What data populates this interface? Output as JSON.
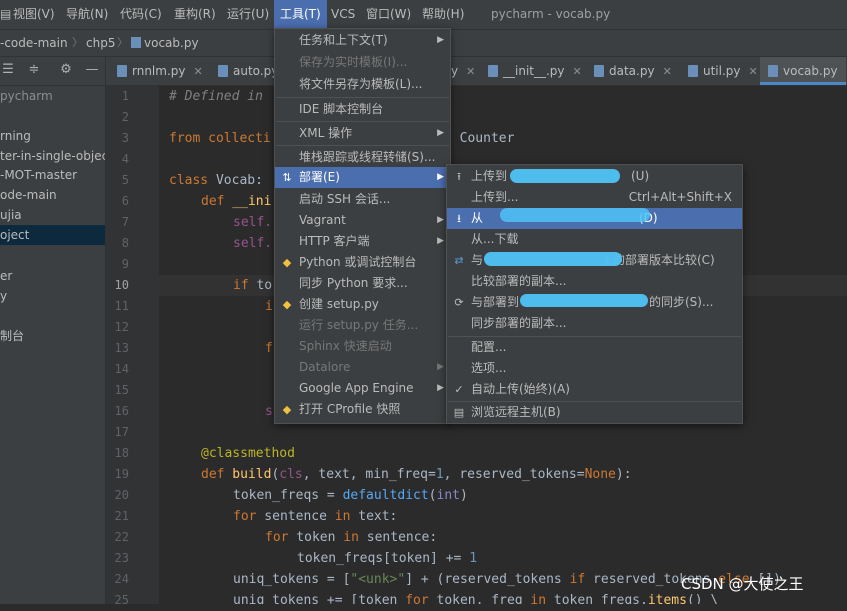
{
  "menubar": {
    "items": [
      "视图(V)",
      "导航(N)",
      "代码(C)",
      "重构(R)",
      "运行(U)",
      "工具(T)",
      "VCS",
      "窗口(W)",
      "帮助(H)"
    ],
    "window_title": "pycharm - vocab.py"
  },
  "breadcrumbs": [
    "-code-main",
    "chp5",
    "vocab.py"
  ],
  "left_panel": {
    "items": [
      "pycharm",
      "rning",
      "ter-in-single-objec",
      "-MOT-master",
      "ode-main",
      "ujia",
      "oject",
      "er",
      "y",
      "制台"
    ]
  },
  "tabs": [
    "rnnlm.py",
    "auto.py",
    "y",
    "__init__.py",
    "data.py",
    "util.py",
    "vocab.py"
  ],
  "line_numbers": [
    "1",
    "2",
    "3",
    "4",
    "5",
    "6",
    "7",
    "8",
    "9",
    "10",
    "11",
    "12",
    "13",
    "14",
    "15",
    "16",
    "17",
    "18",
    "19",
    "20",
    "21",
    "22",
    "23",
    "24",
    "25"
  ],
  "code": {
    "l1": "# Defined in",
    "l3a": "from collecti",
    "l3b": ", Counter",
    "l5a": "class",
    "l5b": " Vocab:",
    "l6a": "def",
    "l6b": " __ini",
    "l7": "self.",
    "l8": "self.",
    "l10a": "if",
    "l10b": " to",
    "l11": "i",
    "l13": "f",
    "l16": "s",
    "l18": "@classmethod",
    "l19a": "def",
    "l19b": " build",
    "l19c": "(",
    "l19d": "cls",
    "l19e": ", text, ",
    "l19f": "min_freq",
    "l19g": "=",
    "l19h": "1",
    "l19i": ", ",
    "l19j": "reserved_tokens",
    "l19k": "=",
    "l19l": "None",
    "l19m": "):",
    "l20a": "token_freqs",
    "l20b": " = ",
    "l20c": "defaultdict",
    "l20d": "(",
    "l20e": "int",
    "l20f": ")",
    "l21a": "for",
    "l21b": " sentence ",
    "l21c": "in",
    "l21d": " text:",
    "l22a": "for",
    "l22b": " token ",
    "l22c": "in",
    "l22d": " sentence:",
    "l23a": "token_freqs[token] += ",
    "l23b": "1",
    "l24a": "uniq_tokens = [",
    "l24b": "\"<unk>\"",
    "l24c": "] + (reserved_tokens ",
    "l24d": "if",
    "l24e": " reserved_tokens ",
    "l24f": "else",
    "l24g": " [])",
    "l25a": "uniq_tokens += [token ",
    "l25b": "for",
    "l25c": " token, freq ",
    "l25d": "in",
    "l25e": " token_freqs.",
    "l25f": "items",
    "l25g": "() \\"
  },
  "tools_menu": {
    "items": [
      {
        "label": "任务和上下文(T)",
        "enabled": true,
        "submenu": true
      },
      {
        "label": "保存为实时模板(I)...",
        "enabled": false
      },
      {
        "label": "将文件另存为模板(L)...",
        "enabled": true
      },
      {
        "label": "IDE 脚本控制台",
        "enabled": true
      },
      {
        "label": "XML 操作",
        "enabled": true,
        "submenu": true
      },
      {
        "label": "堆栈跟踪或线程转储(S)...",
        "enabled": true
      },
      {
        "label": "部署(E)",
        "enabled": true,
        "submenu": true,
        "highlighted": true
      },
      {
        "label": "启动 SSH 会话...",
        "enabled": true
      },
      {
        "label": "Vagrant",
        "enabled": true,
        "submenu": true
      },
      {
        "label": "HTTP 客户端",
        "enabled": true,
        "submenu": true
      },
      {
        "label": "Python 或调试控制台",
        "enabled": true
      },
      {
        "label": "同步 Python 要求...",
        "enabled": true
      },
      {
        "label": "创建 setup.py",
        "enabled": true
      },
      {
        "label": "运行 setup.py 任务...",
        "enabled": false
      },
      {
        "label": "Sphinx 快速启动",
        "enabled": false
      },
      {
        "label": "Datalore",
        "enabled": false,
        "submenu": true
      },
      {
        "label": "Google App Engine",
        "enabled": true,
        "submenu": true
      },
      {
        "label": "打开 CProfile 快照",
        "enabled": true
      }
    ]
  },
  "deploy_menu": {
    "items": [
      {
        "label": "上传到",
        "suffix": "(U)",
        "icon": "upload-icon"
      },
      {
        "label": "上传到...",
        "shortcut": "Ctrl+Alt+Shift+X"
      },
      {
        "label": "从",
        "suffix": "(D)",
        "icon": "download-icon",
        "highlighted": true
      },
      {
        "label": "从...下载"
      },
      {
        "label": "与",
        "suffix": "上的部署版本比较(C)",
        "icon": "compare-icon"
      },
      {
        "label": "比较部署的副本..."
      },
      {
        "label": "与部署到",
        "suffix": "的同步(S)...",
        "icon": "sync-icon"
      },
      {
        "label": "同步部署的副本..."
      },
      {
        "label": "配置..."
      },
      {
        "label": "选项..."
      },
      {
        "label": "自动上传(始终)(A)",
        "icon": "check-icon"
      },
      {
        "label": "浏览远程主机(B)",
        "icon": "server-icon"
      }
    ]
  },
  "watermark": "CSDN @大使之王",
  "colors": {
    "accent": "#4b6eaf",
    "redaction": "#4fc3f7"
  }
}
